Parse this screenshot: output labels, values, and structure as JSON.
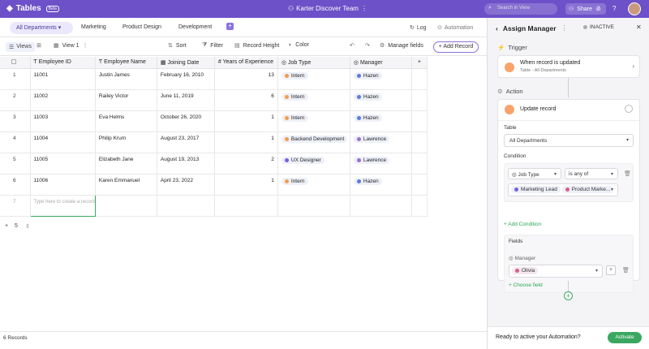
{
  "app": {
    "title": "Tables",
    "badge": "Beta",
    "team": "Karter Discover Team",
    "search_placeholder": "Search in View",
    "share_label": "Share",
    "share_count": "2"
  },
  "tabs": [
    {
      "label": "All Departments"
    },
    {
      "label": "Marketing"
    },
    {
      "label": "Product Design"
    },
    {
      "label": "Development"
    }
  ],
  "top_actions": {
    "log": "Log",
    "automation": "Automation"
  },
  "toolbar": {
    "views": "Views",
    "view_name": "View 1",
    "sort": "Sort",
    "filter": "Filter",
    "record_height": "Record Height",
    "color": "Color",
    "manage_fields": "Manage fields",
    "add_record": "+ Add Record"
  },
  "table": {
    "headers": [
      "Employee ID",
      "Employee Name",
      "Joining Date",
      "Years of Experience",
      "Job Type",
      "Manager"
    ],
    "rows": [
      {
        "n": "1",
        "id": "11001",
        "name": "Justin James",
        "date": "February 16, 2010",
        "years": "13",
        "job": "Intern",
        "job_color": "#f59c4a",
        "mgr": "Hazen",
        "mgr_color": "#5b7be0"
      },
      {
        "n": "2",
        "id": "11002",
        "name": "Railey Victor",
        "date": "June 11, 2019",
        "years": "6",
        "job": "Intern",
        "job_color": "#f59c4a",
        "mgr": "Hazen",
        "mgr_color": "#5b7be0"
      },
      {
        "n": "3",
        "id": "11003",
        "name": "Eva Helms",
        "date": "October 26, 2020",
        "years": "1",
        "job": "Intern",
        "job_color": "#f59c4a",
        "mgr": "Hazen",
        "mgr_color": "#5b7be0"
      },
      {
        "n": "4",
        "id": "11004",
        "name": "Philip Krum",
        "date": "August 23, 2017",
        "years": "1",
        "job": "Backend Development",
        "job_color": "#f59c4a",
        "mgr": "Lawrence",
        "mgr_color": "#9b6fd6"
      },
      {
        "n": "5",
        "id": "11005",
        "name": "Elizabeth Jane",
        "date": "August 19, 2013",
        "years": "2",
        "job": "UX Designer",
        "job_color": "#7b5fe0",
        "mgr": "Lawrence",
        "mgr_color": "#9b6fd6"
      },
      {
        "n": "6",
        "id": "11006",
        "name": "Karen Emmanuel",
        "date": "April 23, 2022",
        "years": "1",
        "job": "Intern",
        "job_color": "#f59c4a",
        "mgr": "Hazen",
        "mgr_color": "#5b7be0"
      }
    ],
    "new_row_n": "7",
    "new_row_placeholder": "Type here to create a record",
    "page_size": "5",
    "footer": "6 Records"
  },
  "panel": {
    "title": "Assign Manager",
    "status": "INACTIVE",
    "trigger_label": "Trigger",
    "trigger_title": "When record is updated",
    "trigger_sub": "Table - All Departments",
    "action_label": "Action",
    "action_title": "Update record",
    "table_label": "Table",
    "table_value": "All Departments",
    "condition_label": "Condition",
    "cond_field": "Job Type",
    "cond_op": "is any of",
    "cond_val1": "Marketing Lead",
    "cond_val2": "Product Marke...",
    "add_condition": "+ Add Condition",
    "fields_label": "Fields",
    "field_name": "Manager",
    "field_value": "Olivia",
    "choose_field": "+ Choose field",
    "ready": "Ready to active your Automation?",
    "activate": "Activate"
  }
}
